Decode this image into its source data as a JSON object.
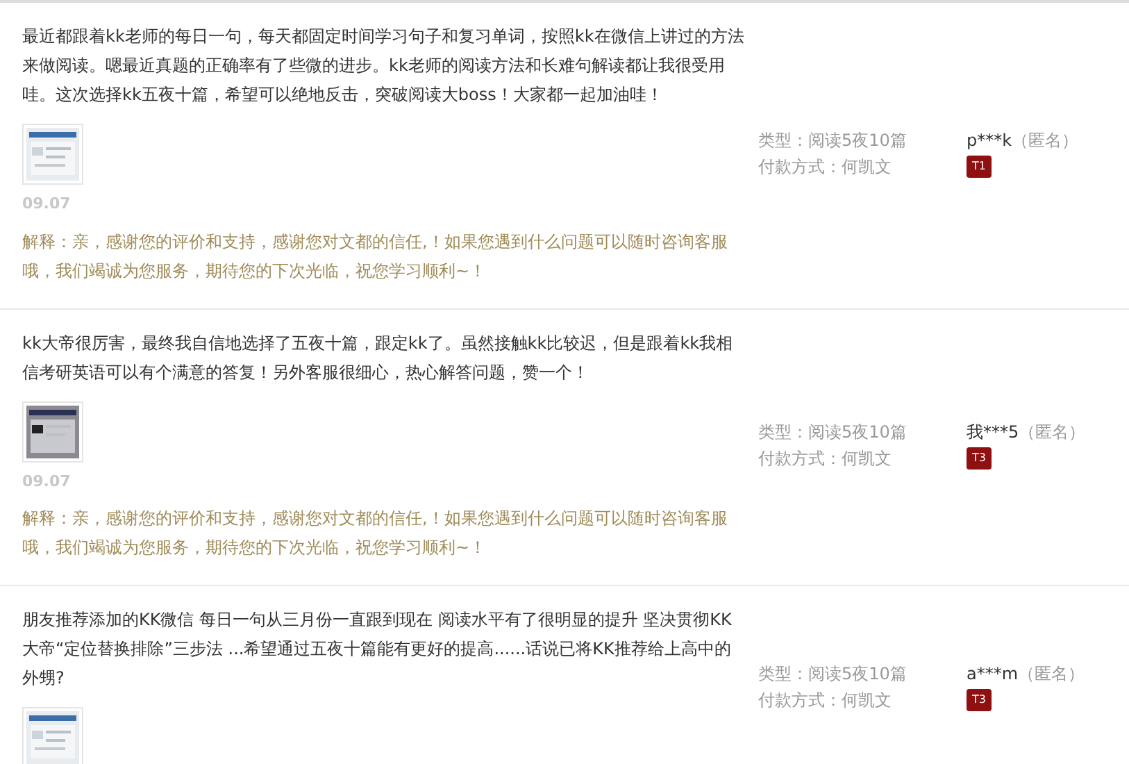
{
  "reviews": [
    {
      "text": "最近都跟着kk老师的每日一句，每天都固定时间学习句子和复习单词，按照kk在微信上讲过的方法来做阅读。嗯最近真题的正确率有了些微的进步。kk老师的阅读方法和长难句解读都让我很受用哇。这次选择kk五夜十篇，希望可以绝地反击，突破阅读大boss！大家都一起加油哇！",
      "date": "09.07",
      "reply": "解释：亲，感谢您的评价和支持，感谢您对文都的信任,！如果您遇到什么问题可以随时咨询客服哦，我们竭诚为您服务，期待您的下次光临，祝您学习顺利~！",
      "type": "类型：阅读5夜10篇",
      "payment": "付款方式：何凯文",
      "user": "p***k",
      "anonymous": "（匿名）",
      "badge": "T1"
    },
    {
      "text": "kk大帝很厉害，最终我自信地选择了五夜十篇，跟定kk了。虽然接触kk比较迟，但是跟着kk我相信考研英语可以有个满意的答复！另外客服很细心，热心解答问题，赞一个！",
      "date": "09.07",
      "reply": "解释：亲，感谢您的评价和支持，感谢您对文都的信任,！如果您遇到什么问题可以随时咨询客服哦，我们竭诚为您服务，期待您的下次光临，祝您学习顺利~！",
      "type": "类型：阅读5夜10篇",
      "payment": "付款方式：何凯文",
      "user": "我***5",
      "anonymous": "（匿名）",
      "badge": "T3"
    },
    {
      "text": "朋友推荐添加的KK微信 每日一句从三月份一直跟到现在 阅读水平有了很明显的提升 坚决贯彻KK大帝“定位替换排除”三步法 ...希望通过五夜十篇能有更好的提高......话说已将KK推荐给上高中的外甥?",
      "type": "类型：阅读5夜10篇",
      "payment": "付款方式：何凯文",
      "user": "a***m",
      "anonymous": "（匿名）",
      "badge": "T3"
    }
  ]
}
